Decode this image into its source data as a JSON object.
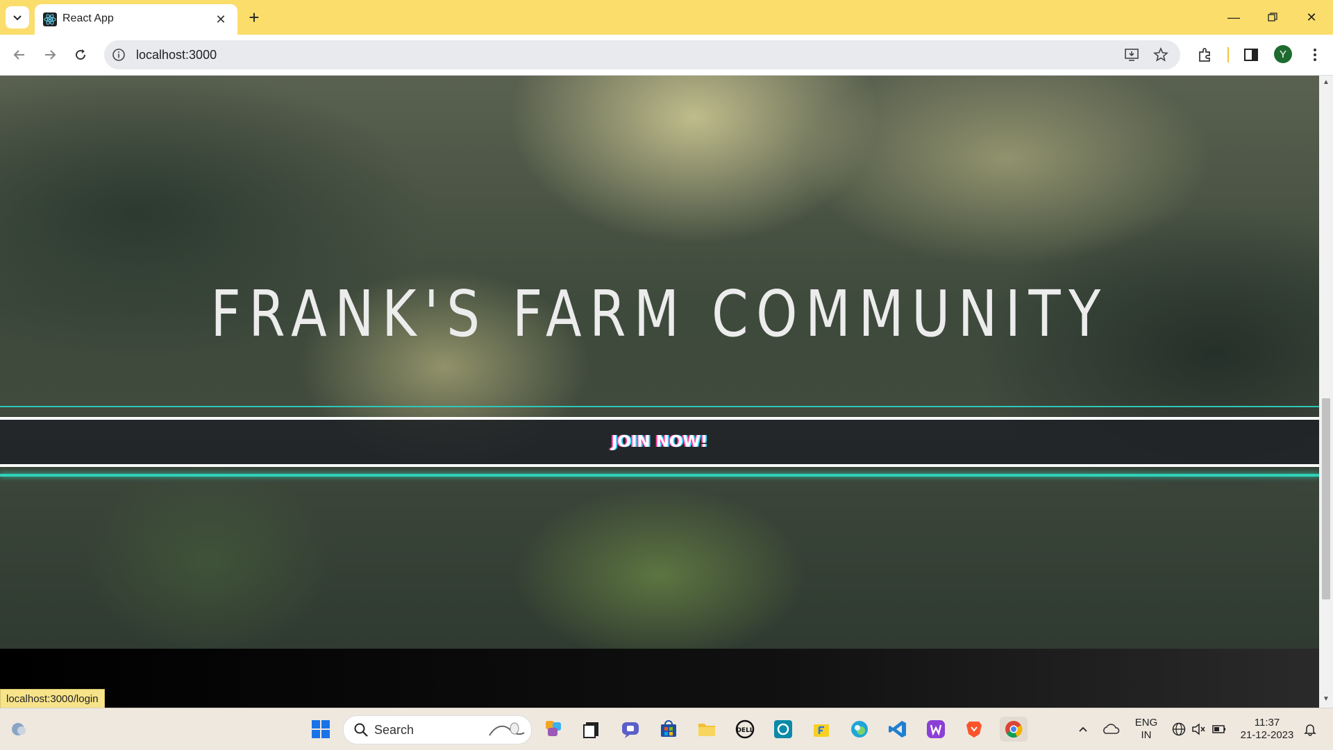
{
  "browser": {
    "tab": {
      "title": "React App"
    },
    "address_bar": {
      "url": "localhost:3000"
    },
    "profile_initial": "Y"
  },
  "page": {
    "hero_title": "FRANK'S FARM COMMUNITY",
    "join_button": "JOIN NOW!"
  },
  "status_bar": {
    "link_preview": "localhost:3000/login"
  },
  "taskbar": {
    "search_placeholder": "Search",
    "language": "ENG",
    "region": "IN",
    "time": "11:37",
    "date": "21-12-2023"
  },
  "colors": {
    "titlebar": "#fbdd6b",
    "accent_teal": "#2fd1b8",
    "profile_avatar": "#1e6b2f"
  }
}
